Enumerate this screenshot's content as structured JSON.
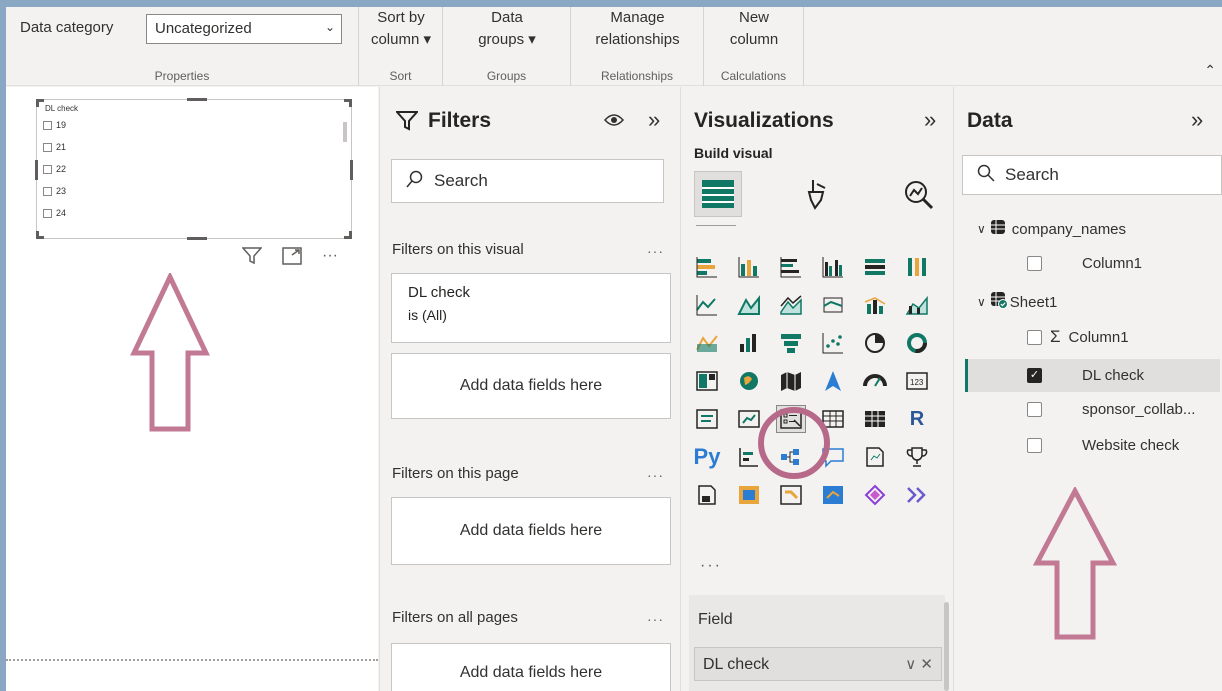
{
  "ribbon": {
    "data_category_label": "Data category",
    "data_category_value": "Uncategorized",
    "properties_label": "Properties",
    "sort_btn": [
      "Sort by",
      "column ▾"
    ],
    "sort_label": "Sort",
    "groups_btn": [
      "Data",
      "groups ▾"
    ],
    "groups_label": "Groups",
    "manage_btn": [
      "Manage",
      "relationships"
    ],
    "relationships_label": "Relationships",
    "newcol_btn": [
      "New",
      "column"
    ],
    "calculations_label": "Calculations"
  },
  "slicer": {
    "title": "DL check",
    "items": [
      "19",
      "21",
      "22",
      "23",
      "24"
    ]
  },
  "filters": {
    "title": "Filters",
    "search_placeholder": "Search",
    "on_visual_label": "Filters on this visual",
    "card_field": "DL check",
    "card_value": "is (All)",
    "add_fields_1": "Add data fields here",
    "on_page_label": "Filters on this page",
    "add_fields_2": "Add data fields here",
    "all_pages_label": "Filters on all pages",
    "add_fields_3": "Add data fields here",
    "more": "···"
  },
  "visualizations": {
    "title": "Visualizations",
    "build_label": "Build visual",
    "more": "···",
    "field_label": "Field",
    "field_value": "DL check",
    "py_label": "Py",
    "r_label": "R"
  },
  "data_pane": {
    "title": "Data",
    "search_placeholder": "Search",
    "tables": [
      {
        "name": "company_names",
        "fields": [
          "Column1"
        ]
      },
      {
        "name": "Sheet1",
        "fields": [
          "Column1",
          "DL check",
          "sponsor_collab...",
          "Website check"
        ]
      }
    ]
  },
  "colors": {
    "accent": "#117865",
    "arrow": "#c27a94",
    "circle": "#b7698a"
  }
}
